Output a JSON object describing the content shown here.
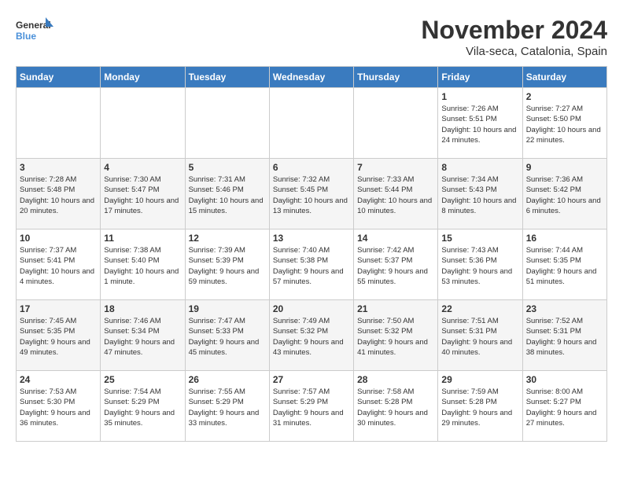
{
  "logo": {
    "line1": "General",
    "line2": "Blue"
  },
  "title": "November 2024",
  "subtitle": "Vila-seca, Catalonia, Spain",
  "days_of_week": [
    "Sunday",
    "Monday",
    "Tuesday",
    "Wednesday",
    "Thursday",
    "Friday",
    "Saturday"
  ],
  "weeks": [
    [
      {
        "day": "",
        "info": ""
      },
      {
        "day": "",
        "info": ""
      },
      {
        "day": "",
        "info": ""
      },
      {
        "day": "",
        "info": ""
      },
      {
        "day": "",
        "info": ""
      },
      {
        "day": "1",
        "info": "Sunrise: 7:26 AM\nSunset: 5:51 PM\nDaylight: 10 hours and 24 minutes."
      },
      {
        "day": "2",
        "info": "Sunrise: 7:27 AM\nSunset: 5:50 PM\nDaylight: 10 hours and 22 minutes."
      }
    ],
    [
      {
        "day": "3",
        "info": "Sunrise: 7:28 AM\nSunset: 5:48 PM\nDaylight: 10 hours and 20 minutes."
      },
      {
        "day": "4",
        "info": "Sunrise: 7:30 AM\nSunset: 5:47 PM\nDaylight: 10 hours and 17 minutes."
      },
      {
        "day": "5",
        "info": "Sunrise: 7:31 AM\nSunset: 5:46 PM\nDaylight: 10 hours and 15 minutes."
      },
      {
        "day": "6",
        "info": "Sunrise: 7:32 AM\nSunset: 5:45 PM\nDaylight: 10 hours and 13 minutes."
      },
      {
        "day": "7",
        "info": "Sunrise: 7:33 AM\nSunset: 5:44 PM\nDaylight: 10 hours and 10 minutes."
      },
      {
        "day": "8",
        "info": "Sunrise: 7:34 AM\nSunset: 5:43 PM\nDaylight: 10 hours and 8 minutes."
      },
      {
        "day": "9",
        "info": "Sunrise: 7:36 AM\nSunset: 5:42 PM\nDaylight: 10 hours and 6 minutes."
      }
    ],
    [
      {
        "day": "10",
        "info": "Sunrise: 7:37 AM\nSunset: 5:41 PM\nDaylight: 10 hours and 4 minutes."
      },
      {
        "day": "11",
        "info": "Sunrise: 7:38 AM\nSunset: 5:40 PM\nDaylight: 10 hours and 1 minute."
      },
      {
        "day": "12",
        "info": "Sunrise: 7:39 AM\nSunset: 5:39 PM\nDaylight: 9 hours and 59 minutes."
      },
      {
        "day": "13",
        "info": "Sunrise: 7:40 AM\nSunset: 5:38 PM\nDaylight: 9 hours and 57 minutes."
      },
      {
        "day": "14",
        "info": "Sunrise: 7:42 AM\nSunset: 5:37 PM\nDaylight: 9 hours and 55 minutes."
      },
      {
        "day": "15",
        "info": "Sunrise: 7:43 AM\nSunset: 5:36 PM\nDaylight: 9 hours and 53 minutes."
      },
      {
        "day": "16",
        "info": "Sunrise: 7:44 AM\nSunset: 5:35 PM\nDaylight: 9 hours and 51 minutes."
      }
    ],
    [
      {
        "day": "17",
        "info": "Sunrise: 7:45 AM\nSunset: 5:35 PM\nDaylight: 9 hours and 49 minutes."
      },
      {
        "day": "18",
        "info": "Sunrise: 7:46 AM\nSunset: 5:34 PM\nDaylight: 9 hours and 47 minutes."
      },
      {
        "day": "19",
        "info": "Sunrise: 7:47 AM\nSunset: 5:33 PM\nDaylight: 9 hours and 45 minutes."
      },
      {
        "day": "20",
        "info": "Sunrise: 7:49 AM\nSunset: 5:32 PM\nDaylight: 9 hours and 43 minutes."
      },
      {
        "day": "21",
        "info": "Sunrise: 7:50 AM\nSunset: 5:32 PM\nDaylight: 9 hours and 41 minutes."
      },
      {
        "day": "22",
        "info": "Sunrise: 7:51 AM\nSunset: 5:31 PM\nDaylight: 9 hours and 40 minutes."
      },
      {
        "day": "23",
        "info": "Sunrise: 7:52 AM\nSunset: 5:31 PM\nDaylight: 9 hours and 38 minutes."
      }
    ],
    [
      {
        "day": "24",
        "info": "Sunrise: 7:53 AM\nSunset: 5:30 PM\nDaylight: 9 hours and 36 minutes."
      },
      {
        "day": "25",
        "info": "Sunrise: 7:54 AM\nSunset: 5:29 PM\nDaylight: 9 hours and 35 minutes."
      },
      {
        "day": "26",
        "info": "Sunrise: 7:55 AM\nSunset: 5:29 PM\nDaylight: 9 hours and 33 minutes."
      },
      {
        "day": "27",
        "info": "Sunrise: 7:57 AM\nSunset: 5:29 PM\nDaylight: 9 hours and 31 minutes."
      },
      {
        "day": "28",
        "info": "Sunrise: 7:58 AM\nSunset: 5:28 PM\nDaylight: 9 hours and 30 minutes."
      },
      {
        "day": "29",
        "info": "Sunrise: 7:59 AM\nSunset: 5:28 PM\nDaylight: 9 hours and 29 minutes."
      },
      {
        "day": "30",
        "info": "Sunrise: 8:00 AM\nSunset: 5:27 PM\nDaylight: 9 hours and 27 minutes."
      }
    ]
  ]
}
